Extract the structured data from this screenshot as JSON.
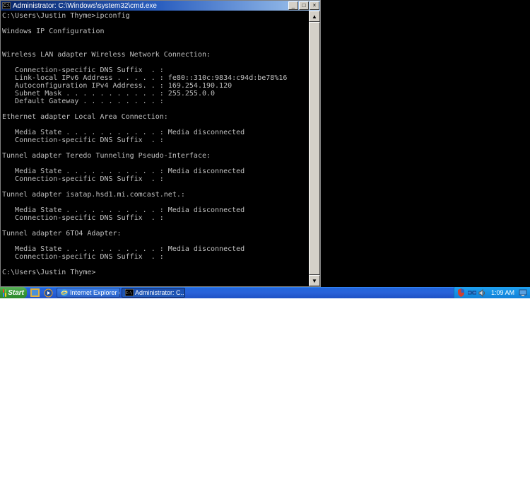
{
  "window": {
    "title": "Administrator: C:\\Windows\\system32\\cmd.exe",
    "minimize": "_",
    "maximize": "□",
    "close": "×"
  },
  "terminal": {
    "prompt1": "C:\\Users\\Justin Thyme>ipconfig",
    "blank": "",
    "header": "Windows IP Configuration",
    "adapters": [
      {
        "title": "Wireless LAN adapter Wireless Network Connection:",
        "lines": [
          "   Connection-specific DNS Suffix  . :",
          "   Link-local IPv6 Address . . . . . : fe80::310c:9834:c94d:be78%16",
          "   Autoconfiguration IPv4 Address. . : 169.254.190.120",
          "   Subnet Mask . . . . . . . . . . . : 255.255.0.0",
          "   Default Gateway . . . . . . . . . :"
        ]
      },
      {
        "title": "Ethernet adapter Local Area Connection:",
        "lines": [
          "   Media State . . . . . . . . . . . : Media disconnected",
          "   Connection-specific DNS Suffix  . :"
        ]
      },
      {
        "title": "Tunnel adapter Teredo Tunneling Pseudo-Interface:",
        "lines": [
          "   Media State . . . . . . . . . . . : Media disconnected",
          "   Connection-specific DNS Suffix  . :"
        ]
      },
      {
        "title": "Tunnel adapter isatap.hsd1.mi.comcast.net.:",
        "lines": [
          "   Media State . . . . . . . . . . . : Media disconnected",
          "   Connection-specific DNS Suffix  . :"
        ]
      },
      {
        "title": "Tunnel adapter 6TO4 Adapter:",
        "lines": [
          "   Media State . . . . . . . . . . . : Media disconnected",
          "   Connection-specific DNS Suffix  . :"
        ]
      }
    ],
    "prompt2": "C:\\Users\\Justin Thyme>"
  },
  "taskbar": {
    "start": "Start",
    "tasks": [
      {
        "label": "Internet Explorer c...",
        "icon": "ie"
      },
      {
        "label": "Administrator: C...",
        "icon": "cmd"
      }
    ],
    "clock": "1:09 AM"
  },
  "icons": {
    "cmd_glyph": "C:\\",
    "scroll_up": "▲",
    "scroll_down": "▼"
  }
}
